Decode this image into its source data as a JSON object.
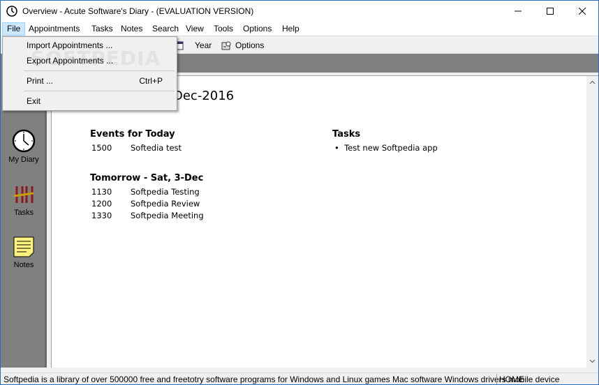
{
  "window": {
    "title": "Overview - Acute Software's Diary - (EVALUATION VERSION)"
  },
  "menubar": {
    "items": [
      "File",
      "Appointments",
      "Tasks",
      "Notes",
      "Search",
      "View",
      "Tools",
      "Options",
      "Help"
    ]
  },
  "toolbar": {
    "year_label": "Year",
    "options_label": "Options"
  },
  "file_menu": {
    "import_label": "Import Appointments ...",
    "export_label": "Export Appointments ...",
    "print_label": "Print ...",
    "print_shortcut": "Ctrl+P",
    "exit_label": "Exit",
    "watermark": "SOFTPEDIA"
  },
  "leftnav": {
    "items": [
      "My Diary",
      "Tasks",
      "Notes"
    ]
  },
  "overview": {
    "date_title": "Dec-2016",
    "today_heading": "Events for Today",
    "today_events": [
      {
        "time": "1500",
        "text": "Softedia test"
      }
    ],
    "tomorrow_heading": "Tomorrow - Sat, 3-Dec",
    "tomorrow_events": [
      {
        "time": "1130",
        "text": "Softpedia Testing"
      },
      {
        "time": "1200",
        "text": "Softpedia Review"
      },
      {
        "time": "1330",
        "text": "Softpedia Meeting"
      }
    ],
    "tasks_heading": "Tasks",
    "tasks": [
      "Test new Softpedia app"
    ]
  },
  "statusbar": {
    "message": "Softpedia is a library of over 500000 free and freetotry software programs for Windows and Linux games Mac software Windows drivers mobile device",
    "mode": "HOME"
  },
  "colors": {
    "menu_highlight": "#cce8ff",
    "nav_bg": "#808080",
    "notes_yellow": "#fff380"
  }
}
